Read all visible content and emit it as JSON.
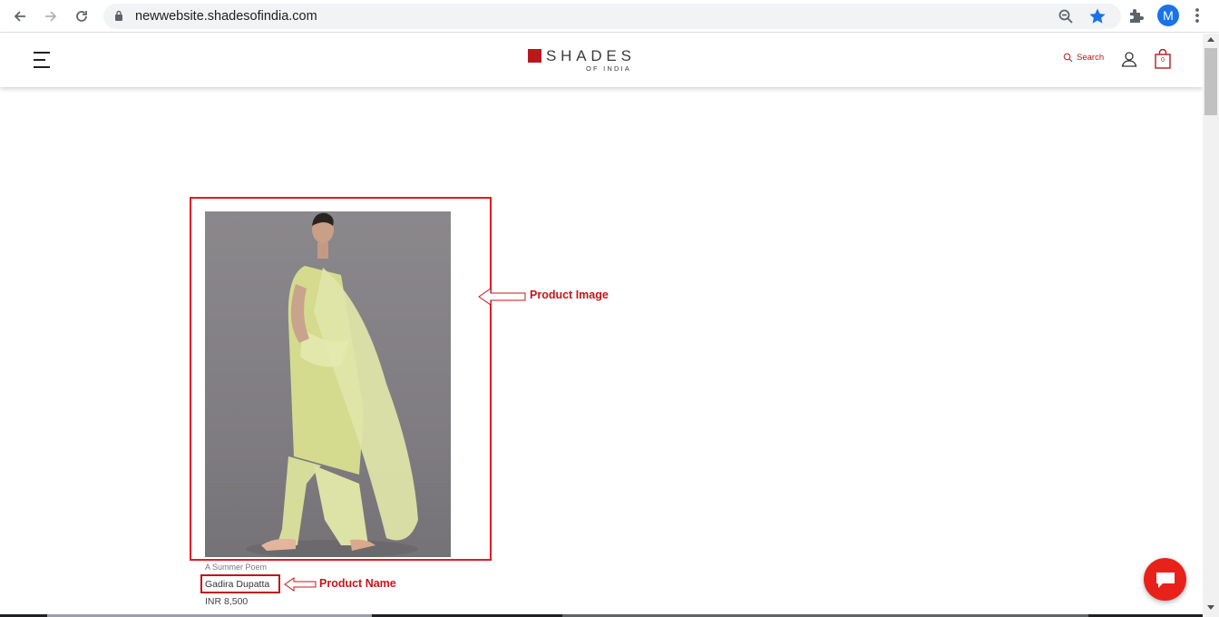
{
  "browser": {
    "url": "newwebsite.shadesofindia.com",
    "profile_initial": "M"
  },
  "header": {
    "logo_main": "SHADES",
    "logo_sub": "OF INDIA",
    "search_label": "Search",
    "cart_count": "0"
  },
  "product": {
    "collection": "A Summer Poem",
    "name": "Gadira Dupatta",
    "price": "INR 8,500"
  },
  "annotations": {
    "image_label": "Product Image",
    "name_label": "Product Name"
  },
  "colors": {
    "brand_red": "#b8191e",
    "annotation_red": "#c8141b",
    "chat_red": "#e8221b"
  }
}
